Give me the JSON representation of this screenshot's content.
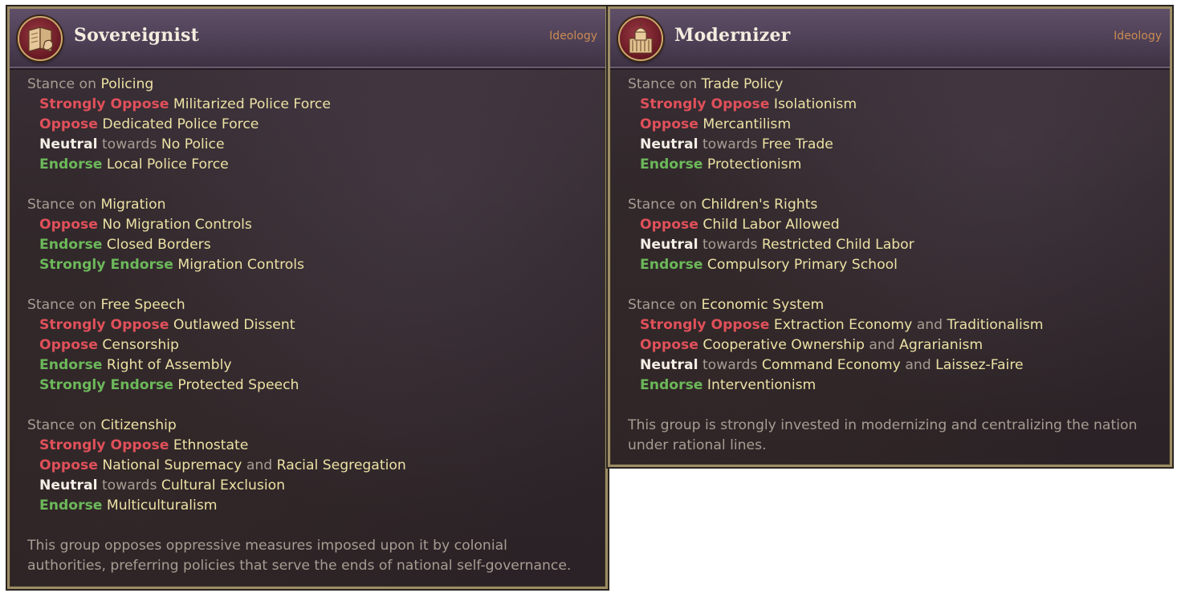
{
  "panels": [
    {
      "title": "Sovereignist",
      "tag": "Ideology",
      "emblem": "book-fist-icon",
      "stances": [
        {
          "stance_label": "Stance on",
          "topic": "Policing",
          "lines": [
            {
              "level": "Strongly Oppose",
              "tone": "red",
              "policies": [
                "Militarized Police Force"
              ]
            },
            {
              "level": "Oppose",
              "tone": "red",
              "policies": [
                "Dedicated Police Force"
              ]
            },
            {
              "level": "Neutral",
              "tone": "white",
              "towards": "towards",
              "policies": [
                "No Police"
              ]
            },
            {
              "level": "Endorse",
              "tone": "green",
              "policies": [
                "Local Police Force"
              ]
            }
          ]
        },
        {
          "stance_label": "Stance on",
          "topic": "Migration",
          "lines": [
            {
              "level": "Oppose",
              "tone": "red",
              "policies": [
                "No Migration Controls"
              ]
            },
            {
              "level": "Endorse",
              "tone": "green",
              "policies": [
                "Closed Borders"
              ]
            },
            {
              "level": "Strongly Endorse",
              "tone": "green",
              "policies": [
                "Migration Controls"
              ]
            }
          ]
        },
        {
          "stance_label": "Stance on",
          "topic": "Free Speech",
          "lines": [
            {
              "level": "Strongly Oppose",
              "tone": "red",
              "policies": [
                "Outlawed Dissent"
              ]
            },
            {
              "level": "Oppose",
              "tone": "red",
              "policies": [
                "Censorship"
              ]
            },
            {
              "level": "Endorse",
              "tone": "green",
              "policies": [
                "Right of Assembly"
              ]
            },
            {
              "level": "Strongly Endorse",
              "tone": "green",
              "policies": [
                "Protected Speech"
              ]
            }
          ]
        },
        {
          "stance_label": "Stance on",
          "topic": "Citizenship",
          "lines": [
            {
              "level": "Strongly Oppose",
              "tone": "red",
              "policies": [
                "Ethnostate"
              ]
            },
            {
              "level": "Oppose",
              "tone": "red",
              "policies": [
                "National Supremacy",
                "Racial Segregation"
              ],
              "joiner": "and"
            },
            {
              "level": "Neutral",
              "tone": "white",
              "towards": "towards",
              "policies": [
                "Cultural Exclusion"
              ]
            },
            {
              "level": "Endorse",
              "tone": "green",
              "policies": [
                "Multiculturalism"
              ]
            }
          ]
        }
      ],
      "description_lines": [
        "This group opposes oppressive measures imposed upon it by colonial",
        "authorities, preferring policies that serve the ends of national self-governance."
      ]
    },
    {
      "title": "Modernizer",
      "tag": "Ideology",
      "emblem": "capitol-building-icon",
      "stances": [
        {
          "stance_label": "Stance on",
          "topic": "Trade Policy",
          "lines": [
            {
              "level": "Strongly Oppose",
              "tone": "red",
              "policies": [
                "Isolationism"
              ]
            },
            {
              "level": "Oppose",
              "tone": "red",
              "policies": [
                "Mercantilism"
              ]
            },
            {
              "level": "Neutral",
              "tone": "white",
              "towards": "towards",
              "policies": [
                "Free Trade"
              ]
            },
            {
              "level": "Endorse",
              "tone": "green",
              "policies": [
                "Protectionism"
              ]
            }
          ]
        },
        {
          "stance_label": "Stance on",
          "topic": "Children's Rights",
          "lines": [
            {
              "level": "Oppose",
              "tone": "red",
              "policies": [
                "Child Labor Allowed"
              ]
            },
            {
              "level": "Neutral",
              "tone": "white",
              "towards": "towards",
              "policies": [
                "Restricted Child Labor"
              ]
            },
            {
              "level": "Endorse",
              "tone": "green",
              "policies": [
                "Compulsory Primary School"
              ]
            }
          ]
        },
        {
          "stance_label": "Stance on",
          "topic": "Economic System",
          "lines": [
            {
              "level": "Strongly Oppose",
              "tone": "red",
              "policies": [
                "Extraction Economy",
                "Traditionalism"
              ],
              "joiner": "and"
            },
            {
              "level": "Oppose",
              "tone": "red",
              "policies": [
                "Cooperative Ownership",
                "Agrarianism"
              ],
              "joiner": "and"
            },
            {
              "level": "Neutral",
              "tone": "white",
              "towards": "towards",
              "policies": [
                "Command Economy",
                "Laissez-Faire"
              ],
              "joiner": "and"
            },
            {
              "level": "Endorse",
              "tone": "green",
              "policies": [
                "Interventionism"
              ]
            }
          ]
        }
      ],
      "description_lines": [
        "This group is strongly invested in modernizing and centralizing the nation",
        "under rational lines."
      ]
    }
  ],
  "colors": {
    "oppose": "#e0505a",
    "endorse": "#6cb85a",
    "neutral": "#f3efe6",
    "policy": "#ece1a4",
    "muted": "#a79d93",
    "tag": "#c98b52",
    "frame": "#9d8d66"
  }
}
